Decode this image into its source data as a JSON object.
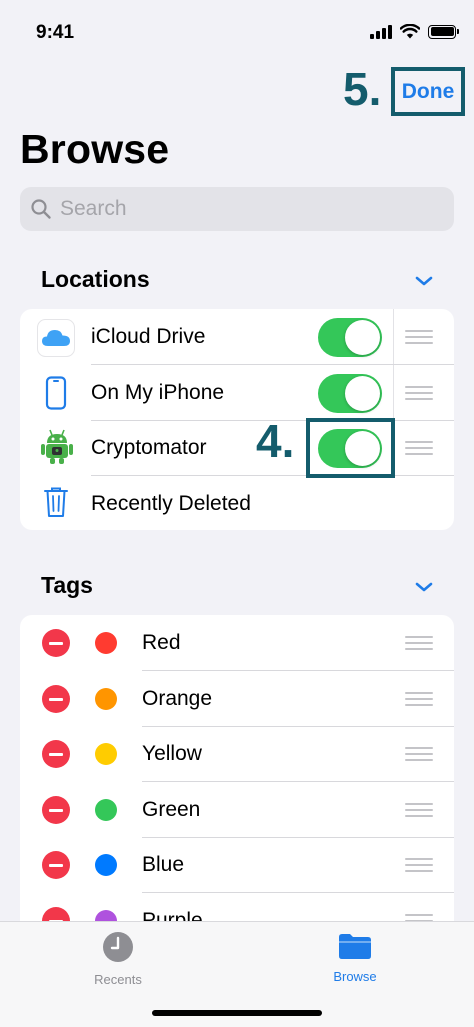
{
  "status_bar": {
    "time": "9:41"
  },
  "annotations": {
    "step_done": "5.",
    "step_toggle": "4."
  },
  "header": {
    "done_label": "Done",
    "title": "Browse"
  },
  "search": {
    "placeholder": "Search"
  },
  "locations": {
    "header": "Locations",
    "items": [
      {
        "label": "iCloud Drive",
        "icon": "icloud-icon",
        "enabled": true
      },
      {
        "label": "On My iPhone",
        "icon": "iphone-icon",
        "enabled": true
      },
      {
        "label": "Cryptomator",
        "icon": "cryptomator-robot-icon",
        "enabled": true
      },
      {
        "label": "Recently Deleted",
        "icon": "trash-icon"
      }
    ]
  },
  "tags": {
    "header": "Tags",
    "items": [
      {
        "label": "Red",
        "color": "#ff3b30"
      },
      {
        "label": "Orange",
        "color": "#ff9500"
      },
      {
        "label": "Yellow",
        "color": "#ffcc00"
      },
      {
        "label": "Green",
        "color": "#34c759"
      },
      {
        "label": "Blue",
        "color": "#007aff"
      },
      {
        "label": "Purple",
        "color": "#af52de"
      }
    ]
  },
  "tab_bar": {
    "recents_label": "Recents",
    "browse_label": "Browse"
  },
  "colors": {
    "accent": "#1f7ce8",
    "toggle_on": "#34c759",
    "annotation": "#145c6c",
    "delete": "#f2374a"
  }
}
